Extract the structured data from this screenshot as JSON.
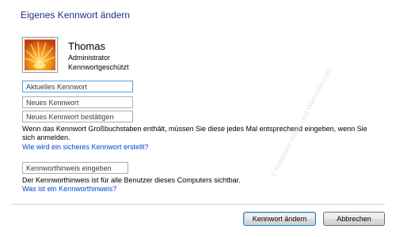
{
  "window": {
    "title": "Eigenes Kennwort ändern"
  },
  "user": {
    "name": "Thomas",
    "role": "Administrator",
    "status": "Kennwortgeschützt",
    "avatar_icon": "flower-avatar-icon"
  },
  "form": {
    "current_password": {
      "placeholder": "Aktuelles Kennwort",
      "value": ""
    },
    "new_password": {
      "placeholder": "Neues Kennwort",
      "value": ""
    },
    "confirm_password": {
      "placeholder": "Neues Kennwort bestätigen",
      "value": ""
    },
    "caps_note_line1": "Wenn das Kennwort Großbuchstaben enthält, müssen Sie diese jedes Mal entsprechend eingeben, wenn Sie",
    "caps_note_line2": "sich anmelden.",
    "strong_password_link": "Wie wird ein sicheres Kennwort erstellt?",
    "hint": {
      "placeholder": "Kennworthinweis eingeben",
      "value": ""
    },
    "hint_note": "Der Kennworthinweis ist für alle Benutzer dieses Computers sichtbar.",
    "hint_link": "Was ist ein Kennworthinweis?"
  },
  "buttons": {
    "change": "Kennwort ändern",
    "cancel": "Abbrechen"
  },
  "watermark": "© Hanimaer-Weiss und Wan-Hilfe.com",
  "colors": {
    "title": "#1e3287",
    "link": "#0046d5",
    "focus_border": "#569de5"
  }
}
